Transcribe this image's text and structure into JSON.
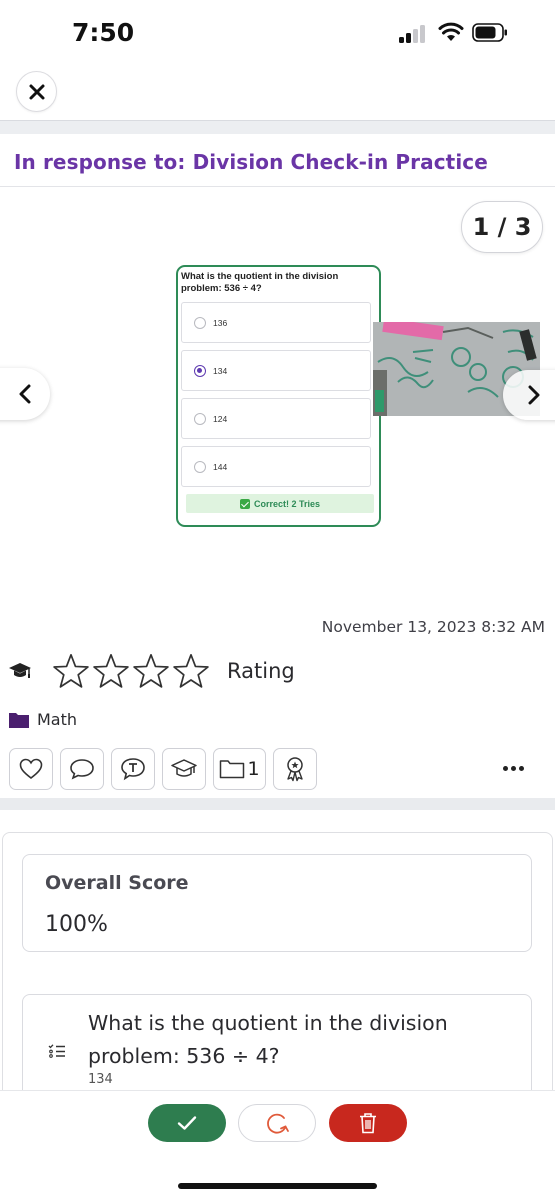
{
  "status_bar": {
    "time": "7:50",
    "signal_bars_on": 2,
    "signal_bars_total": 4
  },
  "header": {
    "close_icon": "close-icon",
    "response_title": "In response to: Division Check-in Practice",
    "page_counter": "1 / 3"
  },
  "quiz": {
    "question": "What is the quotient in the division problem: 536 ÷ 4?",
    "options": [
      {
        "label": "136",
        "selected": false
      },
      {
        "label": "134",
        "selected": true
      },
      {
        "label": "124",
        "selected": false
      },
      {
        "label": "144",
        "selected": false
      }
    ],
    "result": "Correct! 2 Tries"
  },
  "meta": {
    "timestamp": "November 13, 2023 8:32 AM",
    "rating_label": "Rating",
    "rating_stars_filled": 0,
    "rating_stars_total": 4,
    "subject": "Math",
    "folder_count": "1"
  },
  "actions": {
    "icons": [
      "heart-icon",
      "comment-icon",
      "text-comment-icon",
      "graduation-cap-icon",
      "folder-icon",
      "award-icon",
      "more-icon"
    ]
  },
  "score": {
    "title": "Overall Score",
    "value": "100%"
  },
  "question_item": {
    "text": "What is the quotient in the division problem: 536 ÷ 4?",
    "answer": "134"
  },
  "bottom_actions": {
    "icons": [
      "check-icon",
      "retry-icon",
      "trash-icon"
    ]
  },
  "colors": {
    "accent_purple": "#6a35a6",
    "correct_green": "#2e8b57",
    "approve_green": "#2e7d4f",
    "delete_red": "#c8281e"
  }
}
